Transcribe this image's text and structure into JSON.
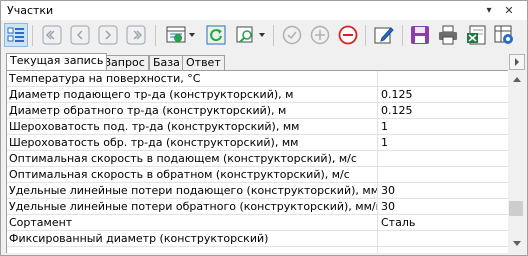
{
  "window": {
    "title": "Участки"
  },
  "titlebar": {
    "pin_glyph": "▾",
    "close_glyph": "✕"
  },
  "icons": {
    "toggle_view": "toggle-view-icon",
    "first": "first-record-icon",
    "prev": "previous-record-icon",
    "next": "next-record-icon",
    "last": "last-record-icon",
    "view_mode": "view-mode-icon",
    "refresh": "refresh-icon",
    "find": "find-icon",
    "apply": "checkmark-icon",
    "add": "add-icon",
    "delete": "delete-icon",
    "edit": "edit-icon",
    "save": "save-icon",
    "print": "print-icon",
    "export_excel": "excel-export-icon",
    "settings": "table-settings-icon"
  },
  "tabs": [
    {
      "label": "Текущая запись",
      "active": true
    },
    {
      "label": "Запрос",
      "active": false
    },
    {
      "label": "База",
      "active": false
    },
    {
      "label": "Ответ",
      "active": false
    }
  ],
  "rows": [
    {
      "param": "Температура на поверхности, °С",
      "value": ""
    },
    {
      "param": "Диаметр подающего тр-да (конструкторский), м",
      "value": "0.125"
    },
    {
      "param": "Диаметр обратного тр-да (конструкторский), м",
      "value": "0.125"
    },
    {
      "param": "Шероховатость под. тр-да (конструкторский), мм",
      "value": "1"
    },
    {
      "param": "Шероховатость обр. тр-да (конструкторский), мм",
      "value": "1"
    },
    {
      "param": "Оптимальная скорость в подающем (конструкторский), м/с",
      "value": ""
    },
    {
      "param": "Оптимальная скорость в обратном (конструкторский), м/с",
      "value": ""
    },
    {
      "param": "Удельные линейные потери подающего (конструкторский), мм/м",
      "value": "30"
    },
    {
      "param": "Удельные линейные потери обратного (конструкторский), мм/м",
      "value": "30"
    },
    {
      "param": "Сортамент",
      "value": "Сталь"
    },
    {
      "param": "Фиксированный диаметр (конструкторский)",
      "value": ""
    }
  ],
  "colors": {
    "nav_disabled": "#9aa5b4",
    "refresh_green": "#27a34a",
    "delete_red": "#d9231f",
    "save_purple": "#8b3fa8",
    "excel_green": "#1e7a3c",
    "accent_blue": "#2b6cc4"
  }
}
